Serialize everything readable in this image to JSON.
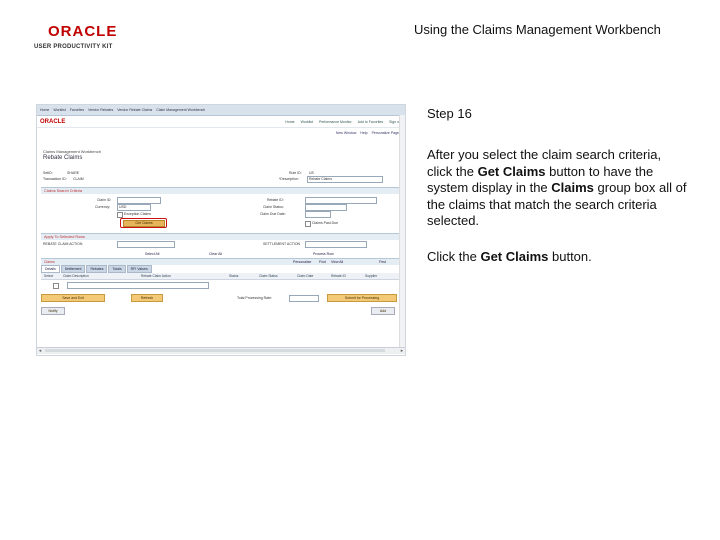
{
  "header": {
    "logo_brand": "ORACLE",
    "logo_product": "USER PRODUCTIVITY KIT",
    "doc_title": "Using the Claims Management Workbench"
  },
  "screenshot": {
    "top_menu": [
      "Home",
      "Worklist",
      "Favorites",
      "Vendor Rebates",
      "Vendor Rebate Claims",
      "Claim Management Workbench"
    ],
    "brand": "ORACLE",
    "top_links": [
      "Home",
      "Worklist",
      "Performance Monitor",
      "Add to Favorites",
      "Sign out"
    ],
    "sub_links": [
      "New Window",
      "Help",
      "Personalize Page"
    ],
    "breadcrumb": "Claims Management Workbench",
    "page_heading": "Rebate Claims",
    "fields": {
      "setid_label": "SetID:",
      "setid_value": "SHARE",
      "transaction_label": "Transaction ID:",
      "transaction_value": "CLAIM",
      "rule_label": "Rule ID:",
      "rule_value": "US",
      "description_label": "*Description:",
      "description_value": "Rebate Claims"
    },
    "section_search": "Claims Search Criteria",
    "search_fields": {
      "claim_id": "Claim ID:",
      "currency": "Currency:",
      "currency_value": "USD",
      "rebate_id": "Rebate ID:",
      "claim_status": "Claim Status:",
      "claim_due_date": "Claim Due Date:",
      "exception_claims": "Exception Claims",
      "claims_past_due": "Claims Past Due"
    },
    "get_claims_button": "Get Claims",
    "section_apply": "Apply To Selected Rows",
    "apply_fields": {
      "rebate_claim_action": "REBATE CLAIM ACTION",
      "settlement_action": "SETTLEMENT ACTION"
    },
    "links_row": [
      "Select All",
      "Clear All",
      "Process Row"
    ],
    "grid_title": "Claims",
    "grid_toolbar": [
      "Personalize",
      "Find",
      "View All",
      "First"
    ],
    "tabs": [
      "Details",
      "Settlement",
      "Rebates",
      "Totals",
      "RFI Values"
    ],
    "grid_columns": [
      "Select",
      "Claim Description",
      "Rebate Claim Action",
      "Status",
      "Claim Status",
      "Claim Date",
      "Rebate ID",
      "Supplier"
    ],
    "bottom_buttons": {
      "save_exit": "Save and Exit",
      "refresh": "Refresh",
      "mark_processing": "Submit for Processing",
      "notify": "Notify",
      "add": "Add"
    },
    "total_label": "Total Processing Rate:"
  },
  "instructions": {
    "step_label": "Step 16",
    "para_1_a": "After you select the claim search criteria, click the ",
    "para_1_b": "Get Claims",
    "para_1_c": " button to have the system display in the ",
    "para_1_d": "Claims",
    "para_1_e": " group box all of the claims that match the search criteria selected.",
    "cta_a": "Click the ",
    "cta_b": "Get Claims",
    "cta_c": " button."
  },
  "colors": {
    "accent_red": "#c00000",
    "highlight_red": "#cc1111",
    "button_orange": "#f3c978"
  }
}
